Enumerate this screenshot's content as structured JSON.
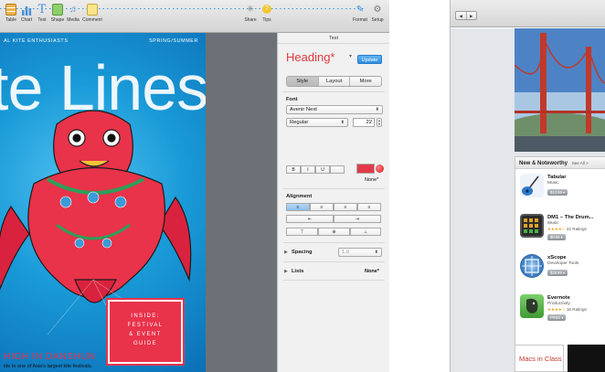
{
  "pages": {
    "toolbar": {
      "left_items": [
        {
          "label": "Table",
          "icon": "table-icon"
        },
        {
          "label": "Chart",
          "icon": "chart-icon"
        },
        {
          "label": "Text",
          "icon": "text-icon"
        },
        {
          "label": "Shape",
          "icon": "shape-icon"
        },
        {
          "label": "Media",
          "icon": "media-icon"
        },
        {
          "label": "Comment",
          "icon": "comment-icon"
        }
      ],
      "right_items": [
        {
          "label": "Share",
          "icon": "share-icon"
        },
        {
          "label": "Tips",
          "icon": "tips-icon"
        },
        {
          "label": "Format",
          "icon": "format-brush-icon"
        },
        {
          "label": "Setup",
          "icon": "gear-icon"
        }
      ]
    },
    "cover": {
      "header_left": "AL KITE ENTHUSIASTS",
      "header_right": "SPRING/SUMMER",
      "title_text": "te Lines",
      "badge_lines": [
        "INSIDE:",
        "FESTIVAL",
        "& EVENT",
        "GUIDE"
      ],
      "story_title": "HIGH IN DANSHUN",
      "story_subtitle": "ide to one of Asia's largest kite festivals."
    },
    "inspector": {
      "title": "Text",
      "paragraph_style": "Heading*",
      "update_label": "Update",
      "tabs": [
        {
          "label": "Style",
          "active": true
        },
        {
          "label": "Layout",
          "active": false
        },
        {
          "label": "More",
          "active": false
        }
      ],
      "font": {
        "section_label": "Font",
        "family": "Avenir Next",
        "typeface": "Regular",
        "size": "22",
        "format_buttons": [
          "B",
          "I",
          "U"
        ],
        "char_style": "None*",
        "color": "#e23a49"
      },
      "alignment": {
        "section_label": "Alignment"
      },
      "spacing": {
        "label": "Spacing",
        "value": "1.0"
      },
      "lists": {
        "label": "Lists",
        "value": "None*"
      }
    }
  },
  "store": {
    "nav": [
      "◀",
      "▶"
    ],
    "section_title": "New & Noteworthy",
    "see_all": "See All >",
    "apps": [
      {
        "name": "Tabular",
        "category": "Music",
        "rating": "",
        "price": "$13.99 ▾"
      },
      {
        "name": "DM1 – The Drum...",
        "category": "Music",
        "rating_stars": "★★★★☆",
        "rating": "22 Ratings",
        "price": "$9.99 ▾"
      },
      {
        "name": "xScope",
        "category": "Developer Tools",
        "rating": "",
        "price": "$29.99 ▾"
      },
      {
        "name": "Evernote",
        "category": "Productivity",
        "rating_stars": "★★★★☆",
        "rating": "16 Ratings",
        "price": "FREE ▾"
      }
    ],
    "banner": "Macs in Class"
  }
}
